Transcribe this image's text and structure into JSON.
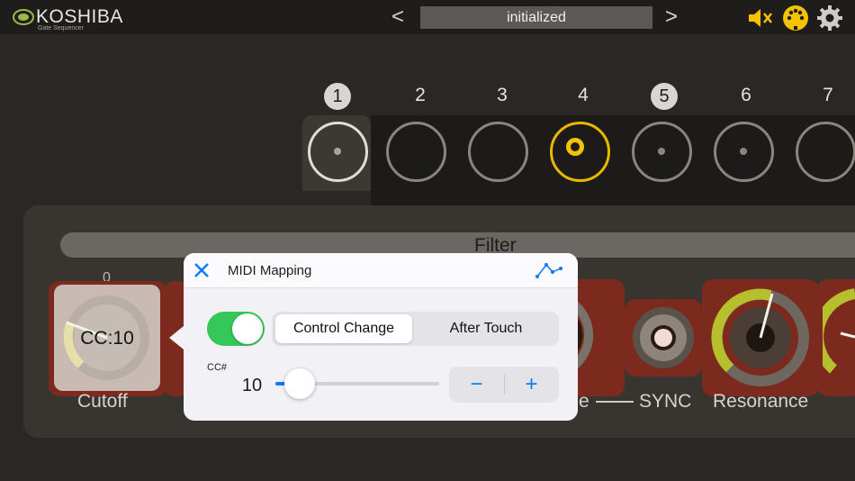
{
  "app": {
    "brand": "KOSHIBA",
    "brand_subtitle": "Gate Sequencer"
  },
  "header": {
    "preset_name": "initialized",
    "prev_label": "<",
    "next_label": ">"
  },
  "icons": {
    "mute": "mute-speaker-icon",
    "midi": "midi-din-icon",
    "settings": "gear-icon"
  },
  "steps": {
    "labels": [
      "1",
      "2",
      "3",
      "4",
      "5",
      "6",
      "7"
    ]
  },
  "panel": {
    "section_title": "Filter",
    "cutoff": {
      "value": "0",
      "mapping": "CC:10",
      "label": "Cutoff"
    },
    "sync_label": "SYNC",
    "sync_prefix": "e",
    "resonance_label": "Resonance"
  },
  "popover": {
    "title": "MIDI Mapping",
    "enabled": true,
    "segments": [
      "Control Change",
      "After Touch"
    ],
    "selected_segment": "Control Change",
    "cc_label": "CC#",
    "cc_value": "10",
    "minus": "−",
    "plus": "+"
  },
  "colors": {
    "accent_yellow": "#f4c300",
    "toggle_green": "#35c759",
    "ios_blue": "#0a7aff",
    "knob_red": "#7b2a1d"
  }
}
